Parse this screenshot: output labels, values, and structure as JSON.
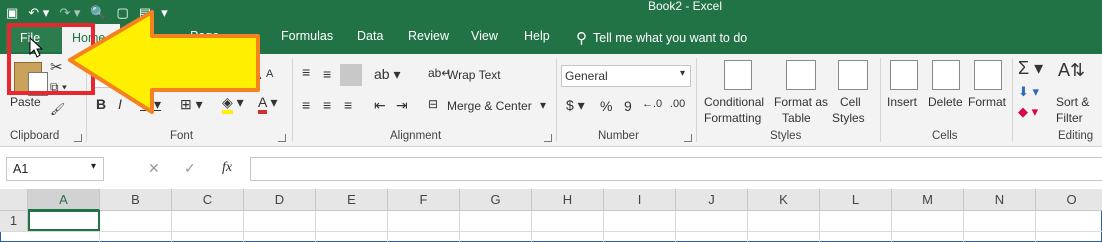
{
  "title": "Book2  -  Excel",
  "tabs": [
    "File",
    "Home",
    "Page",
    "Formulas",
    "Data",
    "Review",
    "View",
    "Help"
  ],
  "tell_me": "Tell me what you want to do",
  "clipboard": {
    "paste": "Paste",
    "label": "Clipboard"
  },
  "font": {
    "label": "Font"
  },
  "alignment": {
    "wrap_text": "Wrap Text",
    "merge_center": "Merge & Center",
    "label": "Alignment"
  },
  "number": {
    "format": "General",
    "currency": "$",
    "percent": "%",
    "comma": "9",
    "label": "Number"
  },
  "styles": {
    "conditional": "Conditional",
    "formatting": "Formatting",
    "format_as": "Format as",
    "table": "Table",
    "cell": "Cell",
    "styles_word": "Styles",
    "label": "Styles"
  },
  "cells": {
    "insert": "Insert",
    "delete": "Delete",
    "format": "Format",
    "label": "Cells"
  },
  "editing": {
    "sort": "Sort &",
    "filter": "Filter",
    "label": "Editing"
  },
  "formula_bar": {
    "name_box": "A1",
    "fx": "fx",
    "cancel": "✕",
    "enter": "✓"
  },
  "columns": [
    "A",
    "B",
    "C",
    "D",
    "E",
    "F",
    "G",
    "H",
    "I",
    "J",
    "K",
    "L",
    "M",
    "N",
    "O"
  ],
  "rows": [
    "1"
  ],
  "colors": {
    "excel_green": "#217346",
    "annotation_red": "#e8262d",
    "arrow_yellow": "#ffef00",
    "arrow_outline": "#f58220"
  }
}
